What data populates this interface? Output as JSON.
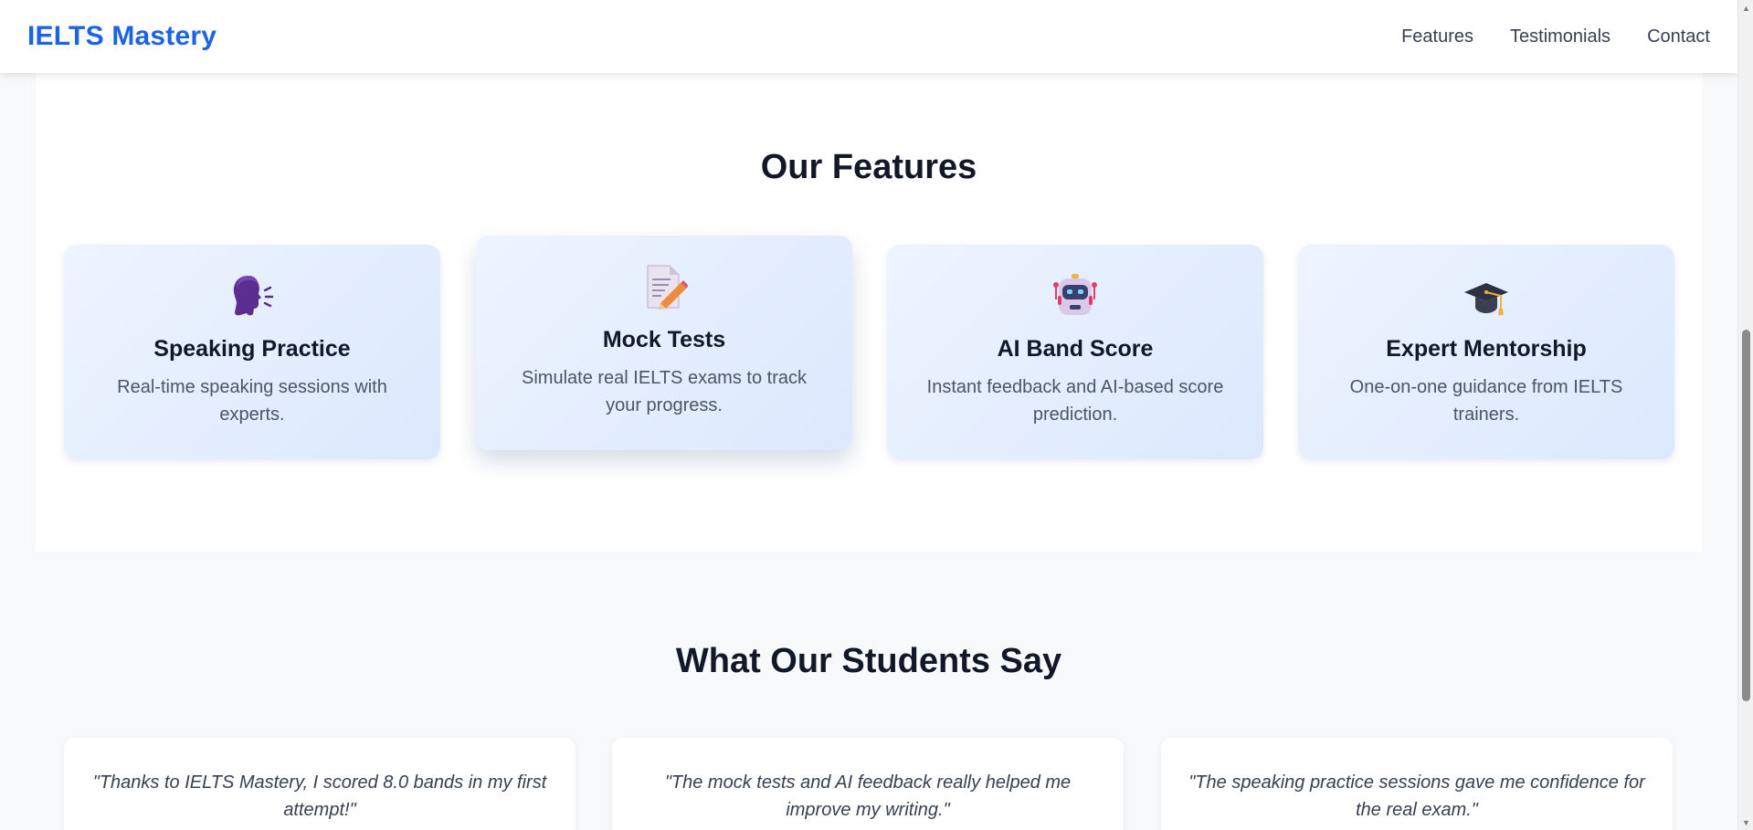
{
  "brand": "IELTS Mastery",
  "nav": {
    "features": "Features",
    "testimonials": "Testimonials",
    "contact": "Contact"
  },
  "features": {
    "title": "Our Features",
    "items": [
      {
        "icon": "speaking-head-icon",
        "title": "Speaking Practice",
        "desc": "Real-time speaking sessions with experts."
      },
      {
        "icon": "memo-icon",
        "title": "Mock Tests",
        "desc": "Simulate real IELTS exams to track your progress."
      },
      {
        "icon": "robot-icon",
        "title": "AI Band Score",
        "desc": "Instant feedback and AI-based score prediction."
      },
      {
        "icon": "graduation-cap-icon",
        "title": "Expert Mentorship",
        "desc": "One-on-one guidance from IELTS trainers."
      }
    ]
  },
  "testimonials": {
    "title": "What Our Students Say",
    "items": [
      {
        "quote": "\"Thanks to IELTS Mastery, I scored 8.0 bands in my first attempt!\""
      },
      {
        "quote": "\"The mock tests and AI feedback really helped me improve my writing.\""
      },
      {
        "quote": "\"The speaking practice sessions gave me confidence for the real exam.\""
      }
    ]
  },
  "colors": {
    "brand": "#1d63e8",
    "card_gradient_start": "#eef4ff",
    "card_gradient_end": "#dbe8fd"
  }
}
